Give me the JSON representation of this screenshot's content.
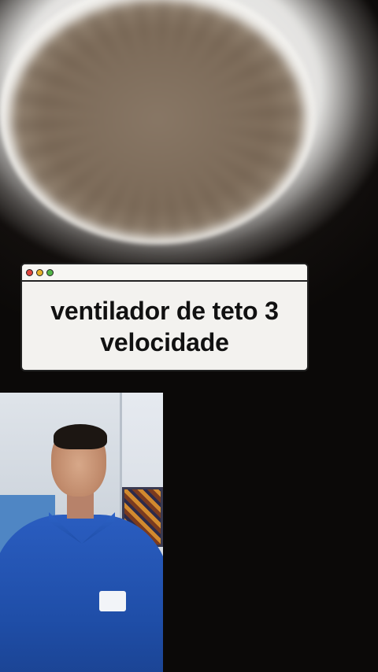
{
  "overlay": {
    "title_line1": "ventilador de teto 3",
    "title_line2": "velocidade"
  },
  "window_dots": [
    {
      "name": "close",
      "color": "#e0443e"
    },
    {
      "name": "minimize",
      "color": "#e6b12a"
    },
    {
      "name": "maximize",
      "color": "#53b548"
    }
  ],
  "scene": {
    "background_subject": "ceiling-fan-light",
    "pip_subject": "presenter-in-blue-shirt"
  }
}
